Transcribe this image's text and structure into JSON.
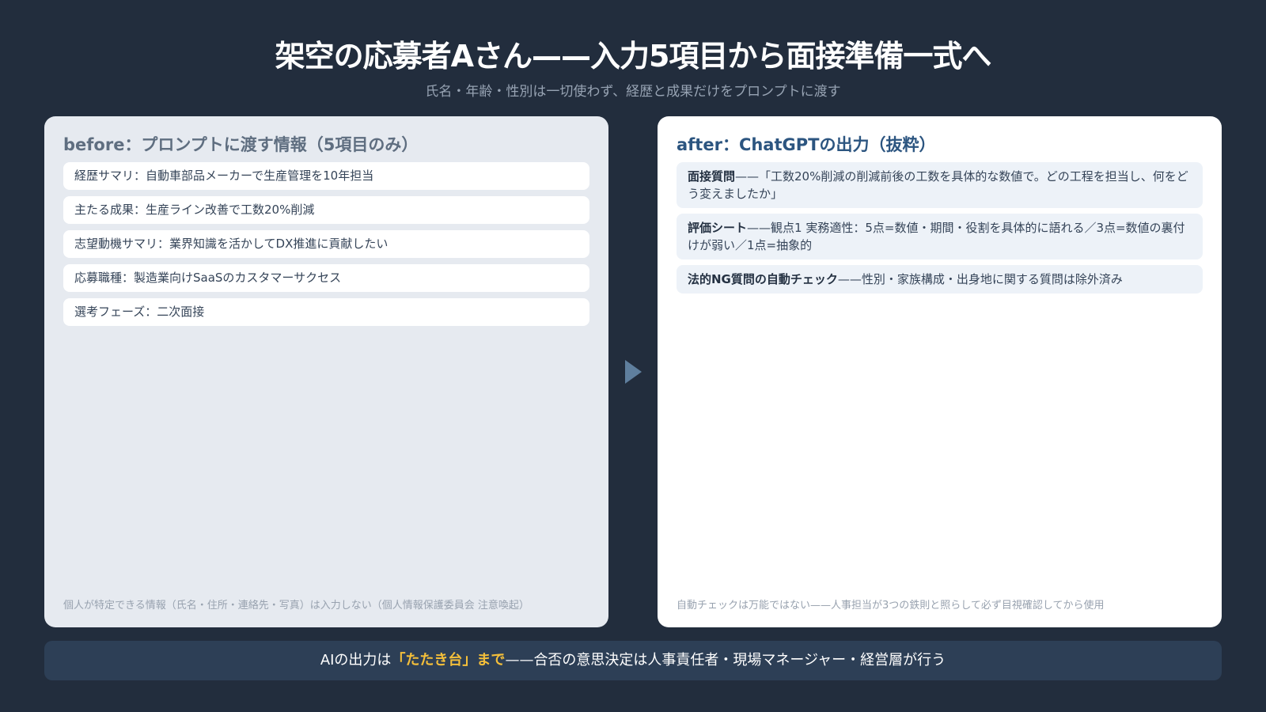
{
  "header": {
    "title": "架空の応募者Aさん——入力5項目から面接準備一式へ",
    "subtitle": "氏名・年齢・性別は一切使わず、経歴と成果だけをプロンプトに渡す"
  },
  "before": {
    "title": "before：プロンプトに渡す情報（5項目のみ）",
    "items": [
      "経歴サマリ：自動車部品メーカーで生産管理を10年担当",
      "主たる成果：生産ライン改善で工数20%削減",
      "志望動機サマリ：業界知識を活かしてDX推進に貢献したい",
      "応募職種：製造業向けSaaSのカスタマーサクセス",
      "選考フェーズ：二次面接"
    ],
    "note": "個人が特定できる情報（氏名・住所・連絡先・写真）は入力しない（個人情報保護委員会 注意喚起）"
  },
  "after": {
    "title": "after：ChatGPTの出力（抜粋）",
    "items": [
      {
        "label": "面接質問",
        "text": "——「工数20%削減の削減前後の工数を具体的な数値で。どの工程を担当し、何をどう変えましたか」"
      },
      {
        "label": "評価シート",
        "text": "——観点1 実務適性：5点=数値・期間・役割を具体的に語れる／3点=数値の裏付けが弱い／1点=抽象的"
      },
      {
        "label": "法的NG質問の自動チェック",
        "text": "——性別・家族構成・出身地に関する質問は除外済み"
      }
    ],
    "note": "自動チェックは万能ではない——人事担当が3つの鉄則と照らして必ず目視確認してから使用"
  },
  "banner": {
    "prefix": "AIの出力は",
    "highlight": "「たたき台」まで",
    "suffix": "——合否の意思決定は人事責任者・現場マネージャー・経営層が行う"
  },
  "icons": {
    "arrow": "triangle-right-icon"
  },
  "colors": {
    "background": "#222d3d",
    "highlight": "#f4bf3a",
    "after_title": "#2c5580"
  }
}
